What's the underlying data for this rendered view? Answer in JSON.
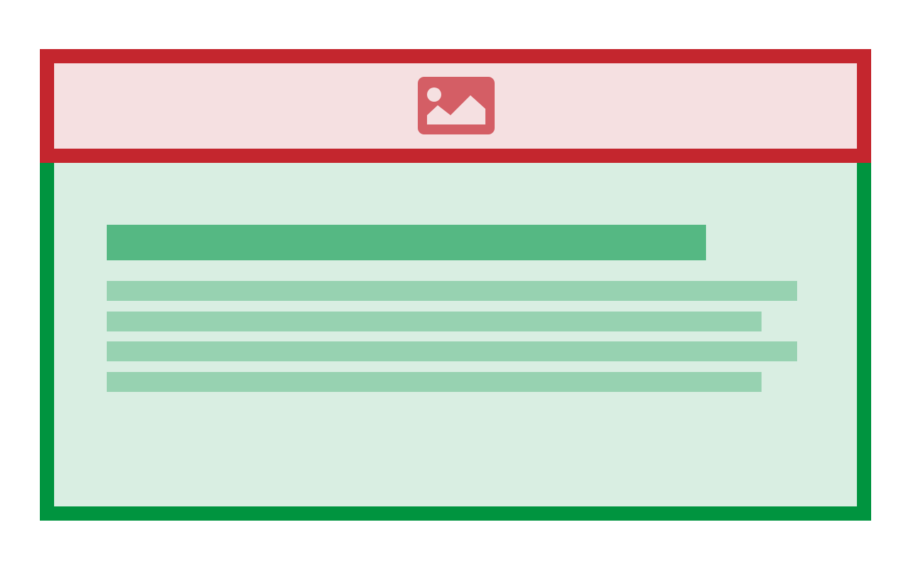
{
  "colors": {
    "header_border": "#c4262e",
    "header_fill": "#f5e0e1",
    "icon_fill": "#d45e65",
    "content_border": "#00943f",
    "content_fill": "#d9eee2",
    "heading_placeholder": "#55b883",
    "text_placeholder": "#97d2b1"
  },
  "header": {
    "icon": "image-icon"
  },
  "content": {
    "heading_placeholder_count": 1,
    "text_line_placeholder_count": 4
  }
}
